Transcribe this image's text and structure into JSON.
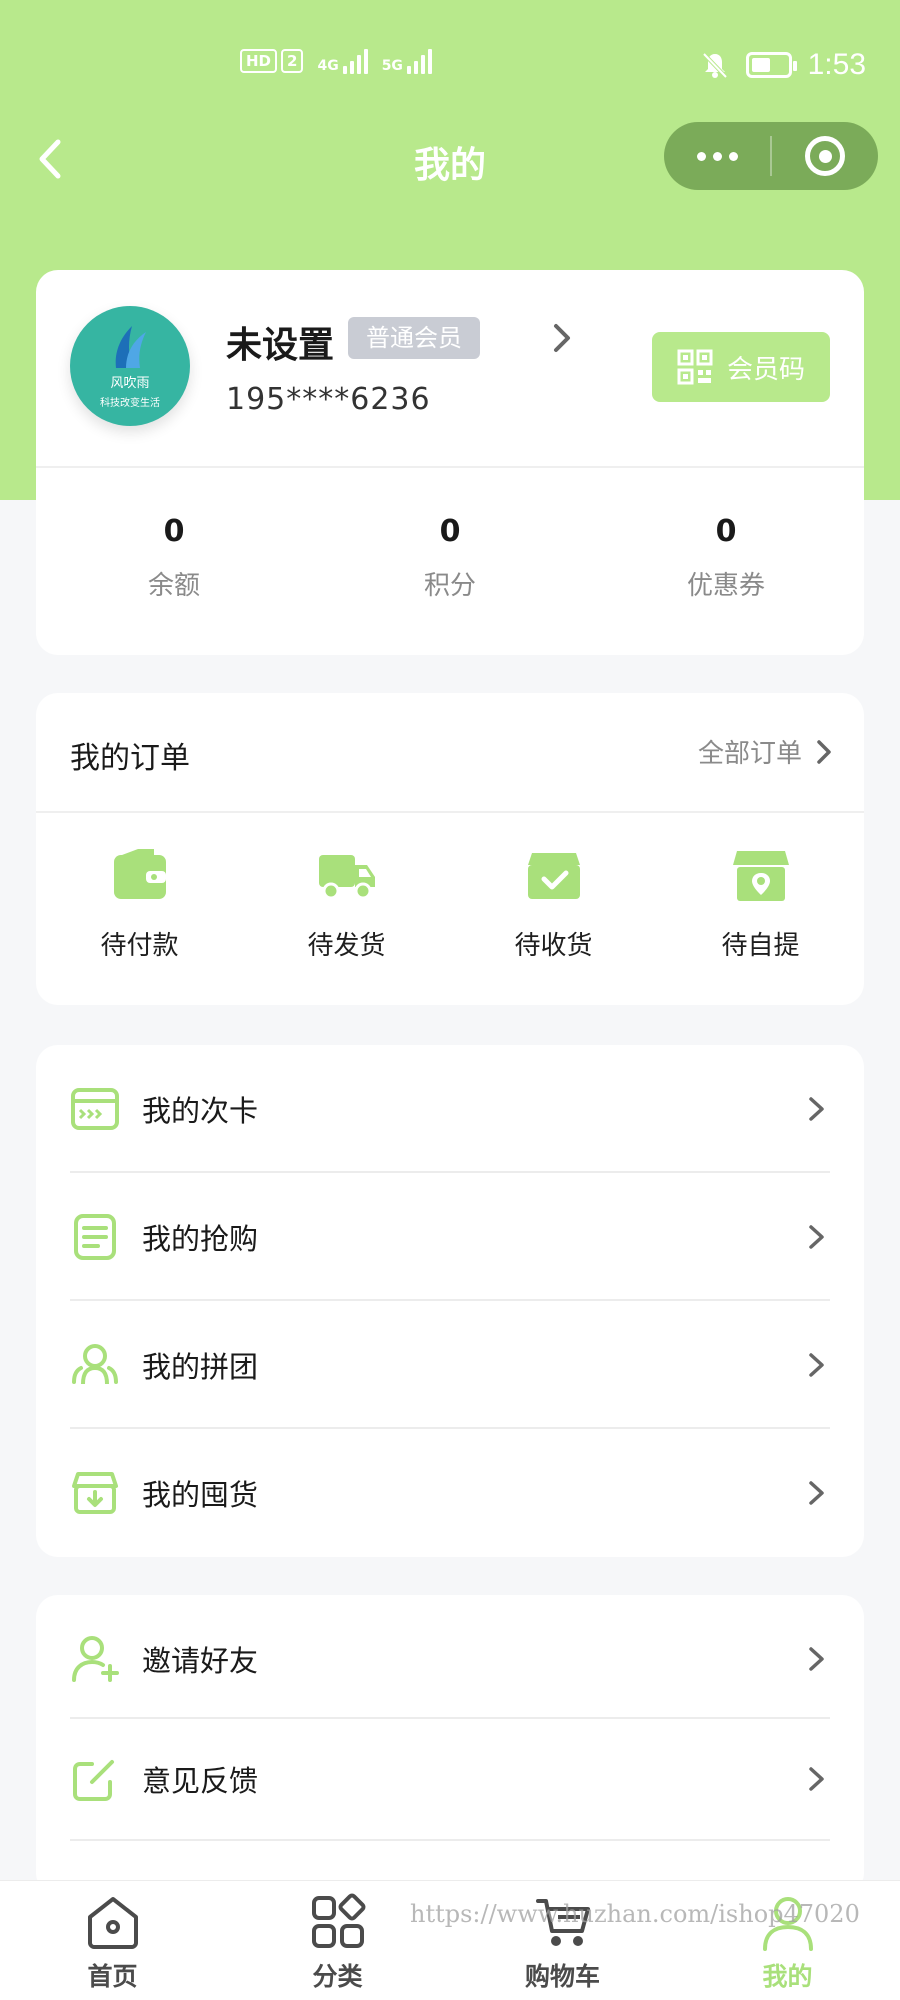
{
  "status_bar": {
    "hd_label": "HD",
    "sim_label": "2",
    "net1": "4G",
    "net2": "5G",
    "time": "1:53"
  },
  "nav": {
    "title": "我的"
  },
  "profile": {
    "name": "未设置",
    "member_level": "普通会员",
    "phone": "195****6236",
    "member_code_label": "会员码",
    "avatar_text": "风吹雨",
    "avatar_sub": "科技改变生活"
  },
  "stats": [
    {
      "value": "0",
      "label": "余额"
    },
    {
      "value": "0",
      "label": "积分"
    },
    {
      "value": "0",
      "label": "优惠券"
    }
  ],
  "orders": {
    "title": "我的订单",
    "all_label": "全部订单",
    "items": [
      {
        "label": "待付款",
        "icon": "wallet-icon"
      },
      {
        "label": "待发货",
        "icon": "truck-icon"
      },
      {
        "label": "待收货",
        "icon": "box-check-icon"
      },
      {
        "label": "待自提",
        "icon": "store-icon"
      }
    ]
  },
  "menu1": [
    {
      "label": "我的次卡",
      "icon": "card-icon"
    },
    {
      "label": "我的抢购",
      "icon": "document-icon"
    },
    {
      "label": "我的拼团",
      "icon": "group-icon"
    },
    {
      "label": "我的囤货",
      "icon": "storage-icon"
    }
  ],
  "menu2": [
    {
      "label": "邀请好友",
      "icon": "add-user-icon"
    },
    {
      "label": "意见反馈",
      "icon": "edit-icon"
    }
  ],
  "tabs": [
    {
      "label": "首页",
      "icon": "home-icon"
    },
    {
      "label": "分类",
      "icon": "category-icon"
    },
    {
      "label": "购物车",
      "icon": "cart-icon"
    },
    {
      "label": "我的",
      "icon": "user-icon",
      "active": true
    }
  ],
  "watermark": "https://www.huzhan.com/ishop47020",
  "colors": {
    "accent": "#b8e98c",
    "capsule": "#7bab59",
    "avatar": "#36b5a2",
    "badge": "#c9ccd4"
  }
}
